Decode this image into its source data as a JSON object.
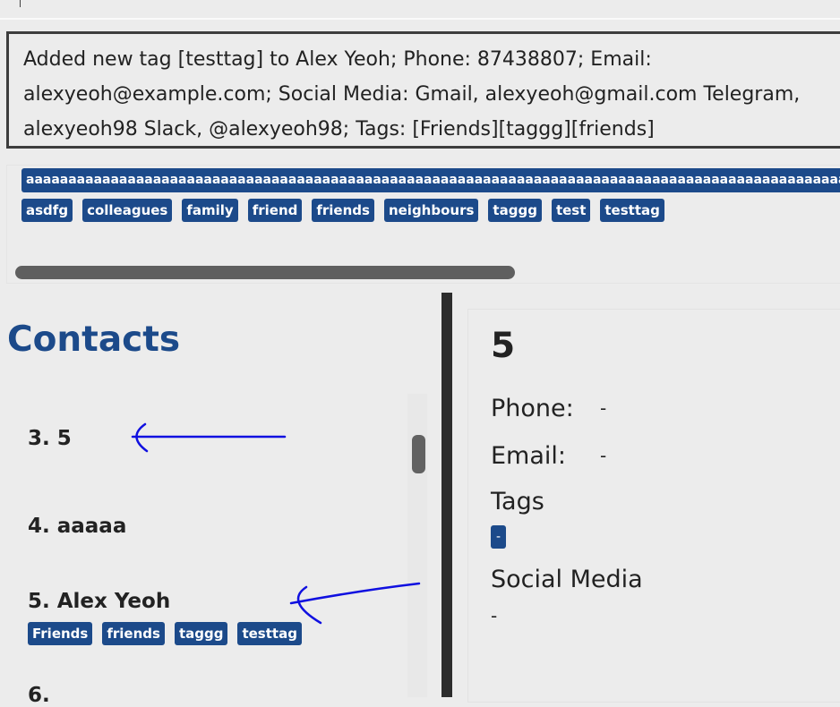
{
  "command_box": {
    "value": ""
  },
  "result": {
    "message": "Added new tag [testtag] to Alex Yeoh; Phone: 87438807; Email: alexyeoh@example.com; Social Media: Gmail, alexyeoh@gmail.com Telegram, alexyeoh98 Slack, @alexyeoh98; Tags: [Friends][taggg][friends]"
  },
  "tag_bar": {
    "long_tag": "aaaaaaaaaaaaaaaaaaaaaaaaaaaaaaaaaaaaaaaaaaaaaaaaaaaaaaaaaaaaaaaaaaaaaaaaaaaaaaaaaaaaaaaaaaaaaaaaaaaaaa",
    "tags": [
      "asdfg",
      "colleagues",
      "family",
      "friend",
      "friends",
      "neighbours",
      "taggg",
      "test",
      "testtag"
    ]
  },
  "contacts": {
    "title": "Contacts",
    "items": [
      {
        "label": "3.  5",
        "tags": []
      },
      {
        "label": "4.  aaaaa",
        "tags": []
      },
      {
        "label": "5.  Alex Yeoh",
        "tags": [
          "Friends",
          "friends",
          "taggg",
          "testtag"
        ]
      },
      {
        "label": "6.  ",
        "tags": []
      }
    ]
  },
  "detail": {
    "name": "5",
    "phone_label": "Phone:",
    "phone_value": "-",
    "email_label": "Email:",
    "email_value": "-",
    "tags_label": "Tags",
    "tag_value": "-",
    "social_label": "Social Media",
    "social_value": "-"
  },
  "colors": {
    "accent": "#1c4a8a",
    "annotation": "#1010e0"
  }
}
